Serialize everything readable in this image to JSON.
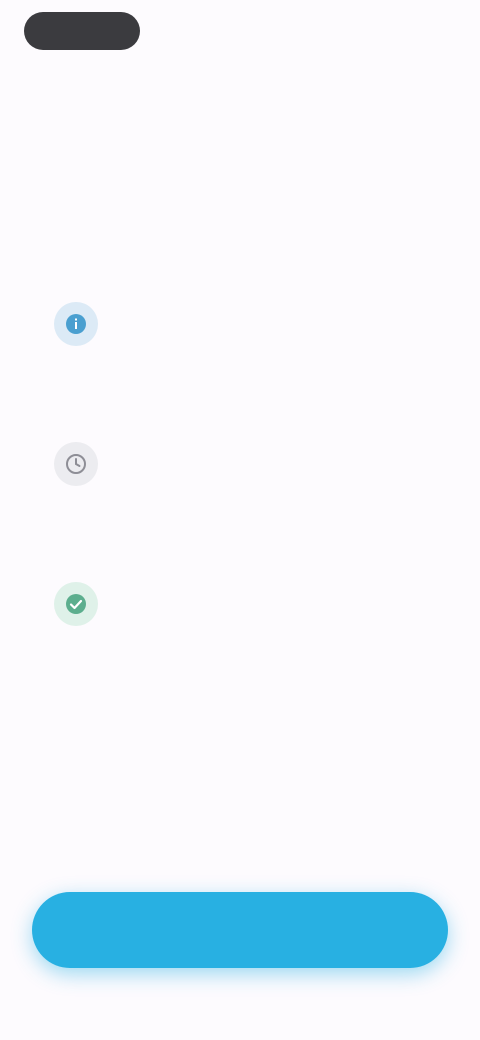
{
  "status_bar": {
    "time": ""
  },
  "header": {
    "back_label": ""
  },
  "intro": {
    "title": ""
  },
  "features": [
    {
      "icon": "info-icon",
      "color": "#4a9fd0",
      "bg": "#dceaf6",
      "title": "",
      "description": ""
    },
    {
      "icon": "clock-icon",
      "color": "#8e8e96",
      "bg": "#ececf0",
      "title": "",
      "description": ""
    },
    {
      "icon": "check-icon",
      "color": "#5cae8e",
      "bg": "#dff1e9",
      "title": "",
      "description": ""
    }
  ],
  "cta": {
    "label": "",
    "color": "#28b0e2"
  }
}
